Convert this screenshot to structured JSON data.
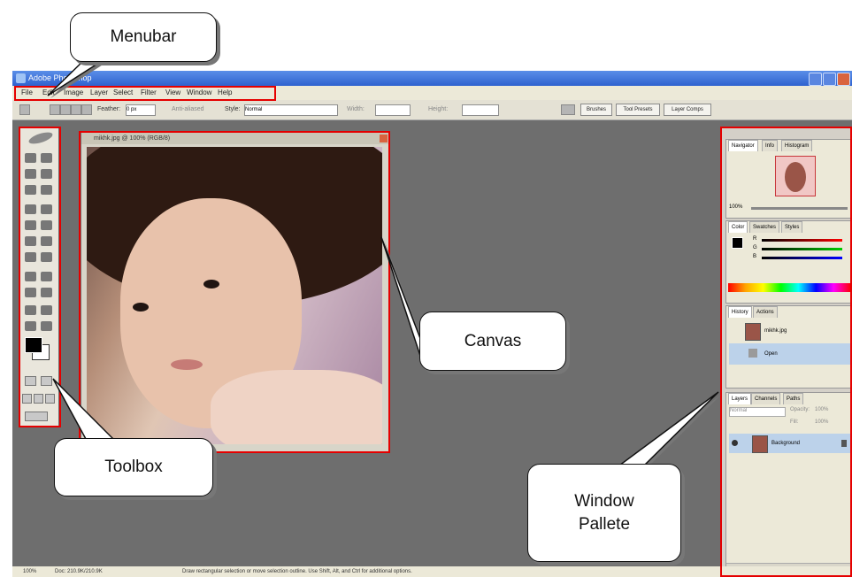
{
  "app": {
    "window_title": "Adobe Photoshop",
    "menu": [
      "File",
      "Edit",
      "Image",
      "Layer",
      "Select",
      "Filter",
      "View",
      "Window",
      "Help"
    ]
  },
  "options_bar": {
    "feather_label": "Feather:",
    "feather_value": "0 px",
    "antialias_label": "Anti-aliased",
    "style_label": "Style:",
    "style_value": "Normal",
    "width_label": "Width:",
    "height_label": "Height:",
    "well_tabs": [
      "Brushes",
      "Tool Presets",
      "Layer Comps"
    ]
  },
  "document": {
    "title": "mikhk.jpg @ 100% (RGB/8)",
    "zoom_label": "100%"
  },
  "palettes": {
    "navigator_tabs": [
      "Navigator",
      "Info",
      "Histogram"
    ],
    "navigator_zoom": "100%",
    "color_tabs": [
      "Color",
      "Swatches",
      "Styles"
    ],
    "color_channels": [
      "R",
      "G",
      "B"
    ],
    "history_tabs": [
      "History",
      "Actions"
    ],
    "history_items": [
      "mikhk.jpg",
      "Open"
    ],
    "layers_tabs": [
      "Layers",
      "Channels",
      "Paths"
    ],
    "layers_blend": "Normal",
    "layers_opacity_label": "Opacity:",
    "layers_opacity_value": "100%",
    "layers_fill_label": "Fill:",
    "layers_fill_value": "100%",
    "layer_name": "Background"
  },
  "status": {
    "zoom": "100%",
    "doc_size": "Doc: 210.9K/210.9K",
    "hint": "Draw rectangular selection or move selection outline. Use Shift, Alt, and Ctrl for additional options."
  },
  "annotations": {
    "menubar": "Menubar",
    "canvas": "Canvas",
    "toolbox": "Toolbox",
    "window_pallete": "Window Pallete"
  },
  "colors": {
    "highlight": "#e50000",
    "workspace": "#6e6e6e",
    "panel": "#ece9d8",
    "titlebar": "#3a6fdc"
  }
}
